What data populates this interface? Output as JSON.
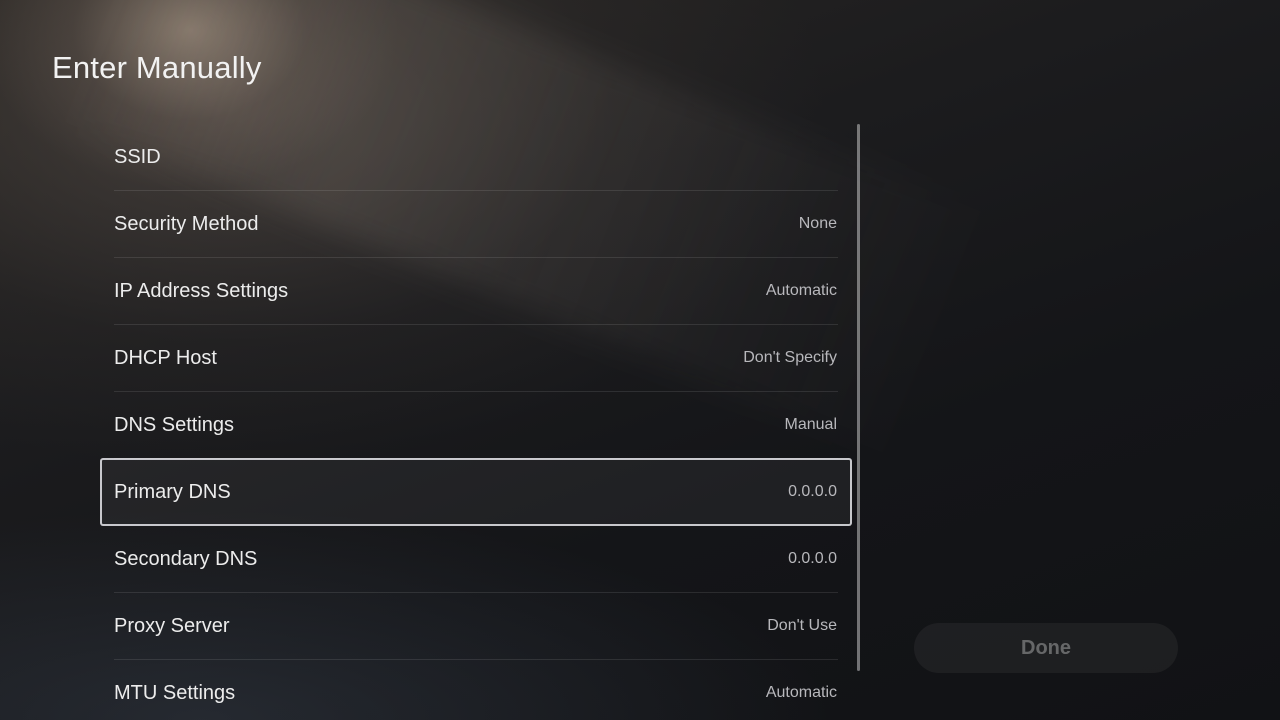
{
  "header": {
    "title": "Enter Manually"
  },
  "settings": {
    "items": [
      {
        "label": "SSID",
        "value": ""
      },
      {
        "label": "Security Method",
        "value": "None"
      },
      {
        "label": "IP Address Settings",
        "value": "Automatic"
      },
      {
        "label": "DHCP Host",
        "value": "Don't Specify"
      },
      {
        "label": "DNS Settings",
        "value": "Manual"
      },
      {
        "label": "Primary DNS",
        "value": "0.0.0.0"
      },
      {
        "label": "Secondary DNS",
        "value": "0.0.0.0"
      },
      {
        "label": "Proxy Server",
        "value": "Don't Use"
      },
      {
        "label": "MTU Settings",
        "value": "Automatic"
      }
    ],
    "selected_index": 5
  },
  "actions": {
    "done_label": "Done"
  }
}
